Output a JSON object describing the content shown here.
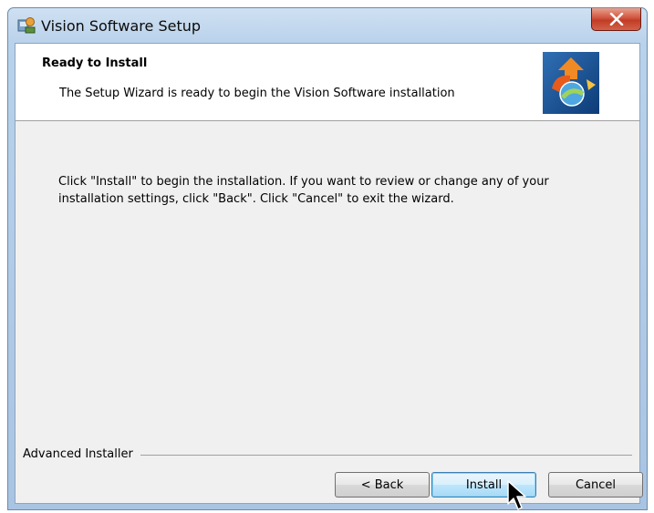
{
  "window": {
    "title": "Vision Software Setup"
  },
  "banner": {
    "title": "Ready to Install",
    "subtitle": "The Setup Wizard is ready to begin the Vision Software installation"
  },
  "main": {
    "instructions": "Click \"Install\" to begin the installation.  If you want to review or change any of your\ninstallation settings, click \"Back\".  Click \"Cancel\" to exit the wizard."
  },
  "footer": {
    "brand_label": "Advanced Installer",
    "back_label": "< Back",
    "install_label": "Install",
    "cancel_label": "Cancel"
  },
  "icons": {
    "app": "setup-app-icon",
    "close": "close-icon",
    "logo": "installer-logo-icon",
    "cursor": "mouse-pointer-icon"
  },
  "colors": {
    "titlebar": "#b9d1ea",
    "close_button": "#c8432c",
    "dialog_background": "#f0f0f0",
    "default_button": "#bee6fd"
  }
}
